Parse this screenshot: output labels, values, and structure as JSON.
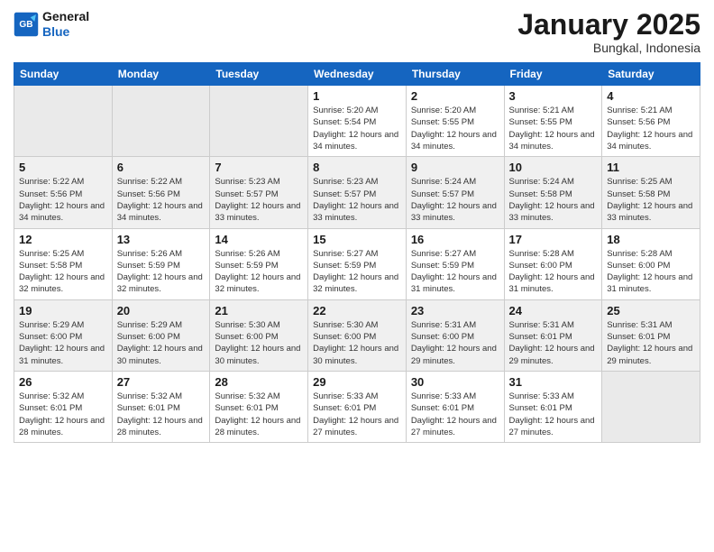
{
  "header": {
    "logo_line1": "General",
    "logo_line2": "Blue",
    "title": "January 2025",
    "subtitle": "Bungkal, Indonesia"
  },
  "days_of_week": [
    "Sunday",
    "Monday",
    "Tuesday",
    "Wednesday",
    "Thursday",
    "Friday",
    "Saturday"
  ],
  "weeks": [
    {
      "row_class": "row-odd",
      "days": [
        {
          "num": "",
          "empty": true
        },
        {
          "num": "",
          "empty": true
        },
        {
          "num": "",
          "empty": true
        },
        {
          "num": "1",
          "sunrise": "5:20 AM",
          "sunset": "5:54 PM",
          "daylight": "12 hours and 34 minutes."
        },
        {
          "num": "2",
          "sunrise": "5:20 AM",
          "sunset": "5:55 PM",
          "daylight": "12 hours and 34 minutes."
        },
        {
          "num": "3",
          "sunrise": "5:21 AM",
          "sunset": "5:55 PM",
          "daylight": "12 hours and 34 minutes."
        },
        {
          "num": "4",
          "sunrise": "5:21 AM",
          "sunset": "5:56 PM",
          "daylight": "12 hours and 34 minutes."
        }
      ]
    },
    {
      "row_class": "row-even",
      "days": [
        {
          "num": "5",
          "sunrise": "5:22 AM",
          "sunset": "5:56 PM",
          "daylight": "12 hours and 34 minutes."
        },
        {
          "num": "6",
          "sunrise": "5:22 AM",
          "sunset": "5:56 PM",
          "daylight": "12 hours and 34 minutes."
        },
        {
          "num": "7",
          "sunrise": "5:23 AM",
          "sunset": "5:57 PM",
          "daylight": "12 hours and 33 minutes."
        },
        {
          "num": "8",
          "sunrise": "5:23 AM",
          "sunset": "5:57 PM",
          "daylight": "12 hours and 33 minutes."
        },
        {
          "num": "9",
          "sunrise": "5:24 AM",
          "sunset": "5:57 PM",
          "daylight": "12 hours and 33 minutes."
        },
        {
          "num": "10",
          "sunrise": "5:24 AM",
          "sunset": "5:58 PM",
          "daylight": "12 hours and 33 minutes."
        },
        {
          "num": "11",
          "sunrise": "5:25 AM",
          "sunset": "5:58 PM",
          "daylight": "12 hours and 33 minutes."
        }
      ]
    },
    {
      "row_class": "row-odd",
      "days": [
        {
          "num": "12",
          "sunrise": "5:25 AM",
          "sunset": "5:58 PM",
          "daylight": "12 hours and 32 minutes."
        },
        {
          "num": "13",
          "sunrise": "5:26 AM",
          "sunset": "5:59 PM",
          "daylight": "12 hours and 32 minutes."
        },
        {
          "num": "14",
          "sunrise": "5:26 AM",
          "sunset": "5:59 PM",
          "daylight": "12 hours and 32 minutes."
        },
        {
          "num": "15",
          "sunrise": "5:27 AM",
          "sunset": "5:59 PM",
          "daylight": "12 hours and 32 minutes."
        },
        {
          "num": "16",
          "sunrise": "5:27 AM",
          "sunset": "5:59 PM",
          "daylight": "12 hours and 31 minutes."
        },
        {
          "num": "17",
          "sunrise": "5:28 AM",
          "sunset": "6:00 PM",
          "daylight": "12 hours and 31 minutes."
        },
        {
          "num": "18",
          "sunrise": "5:28 AM",
          "sunset": "6:00 PM",
          "daylight": "12 hours and 31 minutes."
        }
      ]
    },
    {
      "row_class": "row-even",
      "days": [
        {
          "num": "19",
          "sunrise": "5:29 AM",
          "sunset": "6:00 PM",
          "daylight": "12 hours and 31 minutes."
        },
        {
          "num": "20",
          "sunrise": "5:29 AM",
          "sunset": "6:00 PM",
          "daylight": "12 hours and 30 minutes."
        },
        {
          "num": "21",
          "sunrise": "5:30 AM",
          "sunset": "6:00 PM",
          "daylight": "12 hours and 30 minutes."
        },
        {
          "num": "22",
          "sunrise": "5:30 AM",
          "sunset": "6:00 PM",
          "daylight": "12 hours and 30 minutes."
        },
        {
          "num": "23",
          "sunrise": "5:31 AM",
          "sunset": "6:00 PM",
          "daylight": "12 hours and 29 minutes."
        },
        {
          "num": "24",
          "sunrise": "5:31 AM",
          "sunset": "6:01 PM",
          "daylight": "12 hours and 29 minutes."
        },
        {
          "num": "25",
          "sunrise": "5:31 AM",
          "sunset": "6:01 PM",
          "daylight": "12 hours and 29 minutes."
        }
      ]
    },
    {
      "row_class": "row-odd",
      "days": [
        {
          "num": "26",
          "sunrise": "5:32 AM",
          "sunset": "6:01 PM",
          "daylight": "12 hours and 28 minutes."
        },
        {
          "num": "27",
          "sunrise": "5:32 AM",
          "sunset": "6:01 PM",
          "daylight": "12 hours and 28 minutes."
        },
        {
          "num": "28",
          "sunrise": "5:32 AM",
          "sunset": "6:01 PM",
          "daylight": "12 hours and 28 minutes."
        },
        {
          "num": "29",
          "sunrise": "5:33 AM",
          "sunset": "6:01 PM",
          "daylight": "12 hours and 27 minutes."
        },
        {
          "num": "30",
          "sunrise": "5:33 AM",
          "sunset": "6:01 PM",
          "daylight": "12 hours and 27 minutes."
        },
        {
          "num": "31",
          "sunrise": "5:33 AM",
          "sunset": "6:01 PM",
          "daylight": "12 hours and 27 minutes."
        },
        {
          "num": "",
          "empty": true
        }
      ]
    }
  ],
  "labels": {
    "sunrise": "Sunrise:",
    "sunset": "Sunset:",
    "daylight": "Daylight:"
  }
}
